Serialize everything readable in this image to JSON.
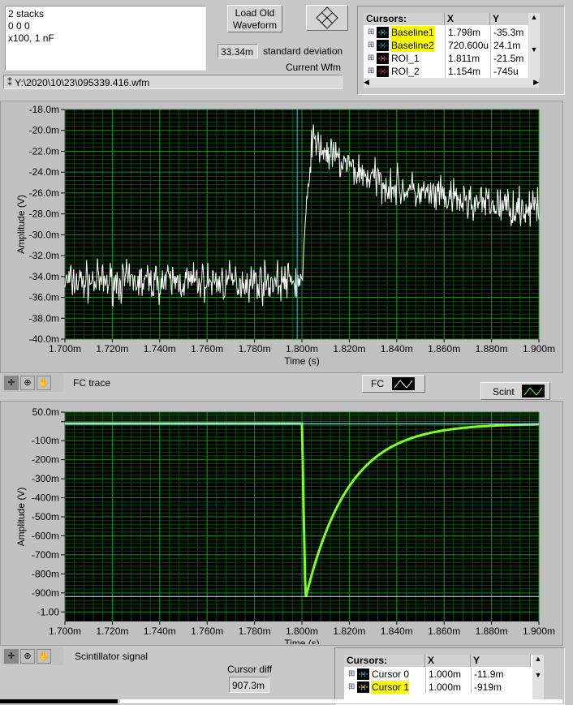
{
  "info_text": [
    "2 stacks",
    "0 0 0",
    "x100, 1 nF"
  ],
  "load_button": "Load Old\nWaveform",
  "std_dev": {
    "value": "33.34m",
    "label": "standard deviation"
  },
  "current_wfm_label": "Current Wfm",
  "file_path": "Y:\\2020\\10\\23\\095339.416.wfm",
  "cursors_top": {
    "headers": [
      "Cursors:",
      "X",
      "Y"
    ],
    "rows": [
      {
        "name": "Baseline1",
        "x": "1.798m",
        "y": "-35.3m",
        "highlight": true,
        "color": "#00e0e0"
      },
      {
        "name": "Baseline2",
        "x": "720.600u",
        "y": "24.1m",
        "highlight": true,
        "color": "#00a0c0"
      },
      {
        "name": "ROI_1",
        "x": "1.811m",
        "y": "-21.5m",
        "highlight": false,
        "color": "#ff6080"
      },
      {
        "name": "ROI_2",
        "x": "1.154m",
        "y": "-745u",
        "highlight": false,
        "color": "#ff2020"
      }
    ]
  },
  "fc_label": "FC trace",
  "fc_legend": "FC",
  "scint_legend": "Scint",
  "scint_label": "Scintillator signal",
  "cursor_diff": {
    "label": "Cursor diff",
    "value": "907.3m"
  },
  "cursors_bottom": {
    "headers": [
      "Cursors:",
      "X",
      "Y"
    ],
    "rows": [
      {
        "name": "Cursor 0",
        "x": "1.000m",
        "y": "-11.9m",
        "highlight": false,
        "color": "#00e0e0"
      },
      {
        "name": "Cursor 1",
        "x": "1.000m",
        "y": "-919m",
        "highlight": true,
        "color": "#ffff00"
      }
    ]
  },
  "chart_data": [
    {
      "type": "line",
      "title": "FC trace",
      "xlabel": "Time (s)",
      "ylabel": "Amplitude (V)",
      "xlim": [
        0.0017,
        0.0019
      ],
      "ylim": [
        -0.04,
        -0.018
      ],
      "xticks": [
        "1.700m",
        "1.720m",
        "1.740m",
        "1.760m",
        "1.780m",
        "1.800m",
        "1.820m",
        "1.840m",
        "1.860m",
        "1.880m",
        "1.900m"
      ],
      "yticks": [
        "-18.0m",
        "-20.0m",
        "-22.0m",
        "-24.0m",
        "-26.0m",
        "-28.0m",
        "-30.0m",
        "-32.0m",
        "-34.0m",
        "-36.0m",
        "-38.0m",
        "-40.0m"
      ],
      "series": [
        {
          "name": "FC",
          "color": "#ffffff",
          "baseline": -0.0345,
          "step_time": 0.0018,
          "peak": -0.021,
          "settle": -0.028,
          "noise": 0.0015
        }
      ],
      "cursor_x": 0.001798,
      "grid": true
    },
    {
      "type": "line",
      "title": "Scintillator signal",
      "xlabel": "Time (s)",
      "ylabel": "Amplitude (V)",
      "xlim": [
        0.0017,
        0.0019
      ],
      "ylim": [
        -1.05,
        0.05
      ],
      "xticks": [
        "1.700m",
        "1.720m",
        "1.740m",
        "1.760m",
        "1.780m",
        "1.800m",
        "1.820m",
        "1.840m",
        "1.860m",
        "1.880m",
        "1.900m"
      ],
      "yticks": [
        "50.0m",
        "",
        "-100m",
        "-200m",
        "-300m",
        "-400m",
        "-500m",
        "-600m",
        "-700m",
        "-800m",
        "-900m",
        "-1.00"
      ],
      "series": [
        {
          "name": "Scint",
          "color": "#80ff20",
          "baseline": -0.01,
          "step_time": 0.0018,
          "min": -0.93,
          "tau": 1.8e-05
        }
      ],
      "cursor_y": [
        -0.0119,
        -0.919
      ],
      "grid": true
    }
  ]
}
